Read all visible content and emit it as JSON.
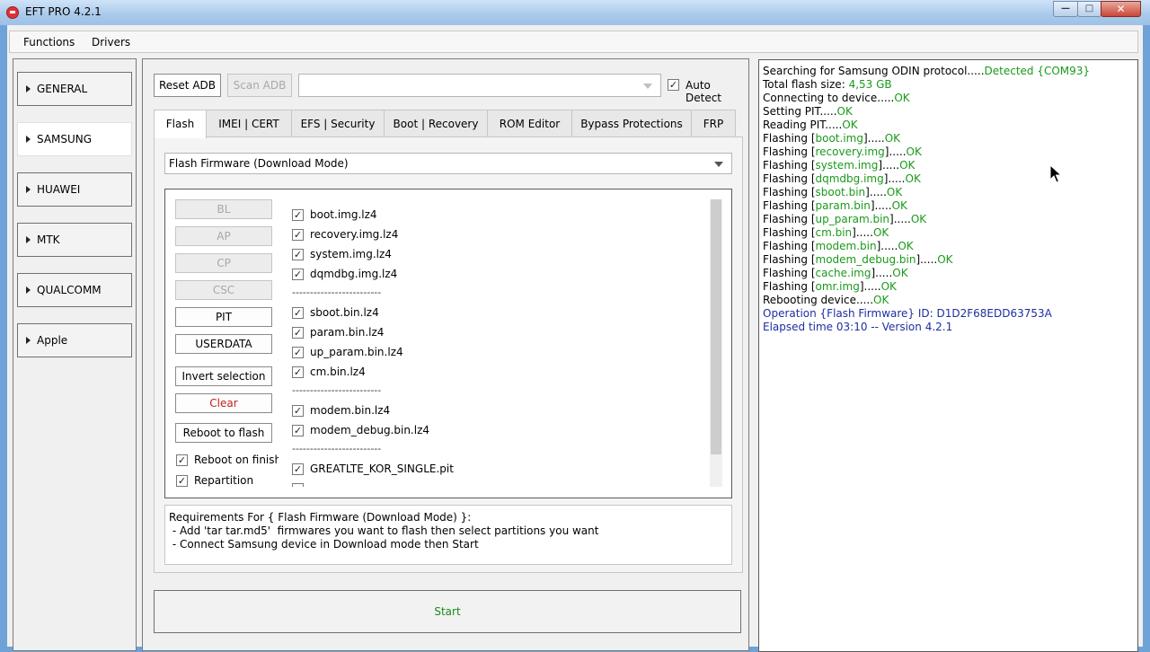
{
  "window": {
    "title": "EFT PRO 4.2.1"
  },
  "menu": [
    "Functions",
    "Drivers"
  ],
  "sidebar": {
    "items": [
      "GENERAL",
      "SAMSUNG",
      "HUAWEI",
      "MTK",
      "QUALCOMM",
      "Apple"
    ],
    "active_index": 1
  },
  "toolbar": {
    "reset_adb": "Reset ADB",
    "scan_adb": "Scan ADB",
    "device_combo_value": "",
    "auto_detect_label": "Auto Detect",
    "auto_detect_checked": true
  },
  "tabs": [
    "Flash",
    "IMEI | CERT",
    "EFS | Security",
    "Boot | Recovery",
    "ROM Editor",
    "Bypass Protections",
    "FRP"
  ],
  "mode_combo": {
    "value": "Flash Firmware (Download Mode)"
  },
  "file_buttons": {
    "bl": "BL",
    "ap": "AP",
    "cp": "CP",
    "csc": "CSC",
    "pit": "PIT",
    "userdata": "USERDATA"
  },
  "actions": {
    "invert": "Invert selection",
    "clear": "Clear",
    "reboot_to_flash": "Reboot to flash"
  },
  "options": {
    "reboot_on_finish": "Reboot on finish",
    "repartition": "Repartition"
  },
  "partitions": {
    "group1": [
      "boot.img.lz4",
      "recovery.img.lz4",
      "system.img.lz4",
      "dqmdbg.img.lz4"
    ],
    "group2": [
      "sboot.bin.lz4",
      "param.bin.lz4",
      "up_param.bin.lz4",
      "cm.bin.lz4"
    ],
    "group3": [
      "modem.bin.lz4",
      "modem_debug.bin.lz4"
    ],
    "group4": [
      "GREATLTE_KOR_SINGLE.pit"
    ],
    "separator": "-------------------------"
  },
  "requirements": {
    "title": "Requirements For { Flash Firmware (Download Mode) }:",
    "line1": " - Add 'tar tar.md5'  firmwares you want to flash then select partitions you want",
    "line2": " - Connect Samsung device in Download mode then Start"
  },
  "start_label": "Start",
  "log": {
    "searching": "Searching for Samsung ODIN protocol.....",
    "detected": "Detected {COM93}",
    "total_size_label": "Total flash size: ",
    "total_size_value": "4,53 GB",
    "connecting": "Connecting to device.....",
    "setting_pit": "Setting PIT.....",
    "reading_pit": "Reading PIT.....",
    "flashing_prefix": "Flashing [",
    "flashing_suffix": "].....",
    "ok": "OK",
    "flash_files": [
      "boot.img",
      "recovery.img",
      "system.img",
      "dqmdbg.img",
      "sboot.bin",
      "param.bin",
      "up_param.bin",
      "cm.bin",
      "modem.bin",
      "modem_debug.bin",
      "cache.img",
      "omr.img"
    ],
    "rebooting": "Rebooting device.....",
    "operation": "Operation {Flash Firmware} ID: D1D2F68EDD63753A",
    "elapsed": "Elapsed time 03:10 -- Version 4.2.1"
  }
}
